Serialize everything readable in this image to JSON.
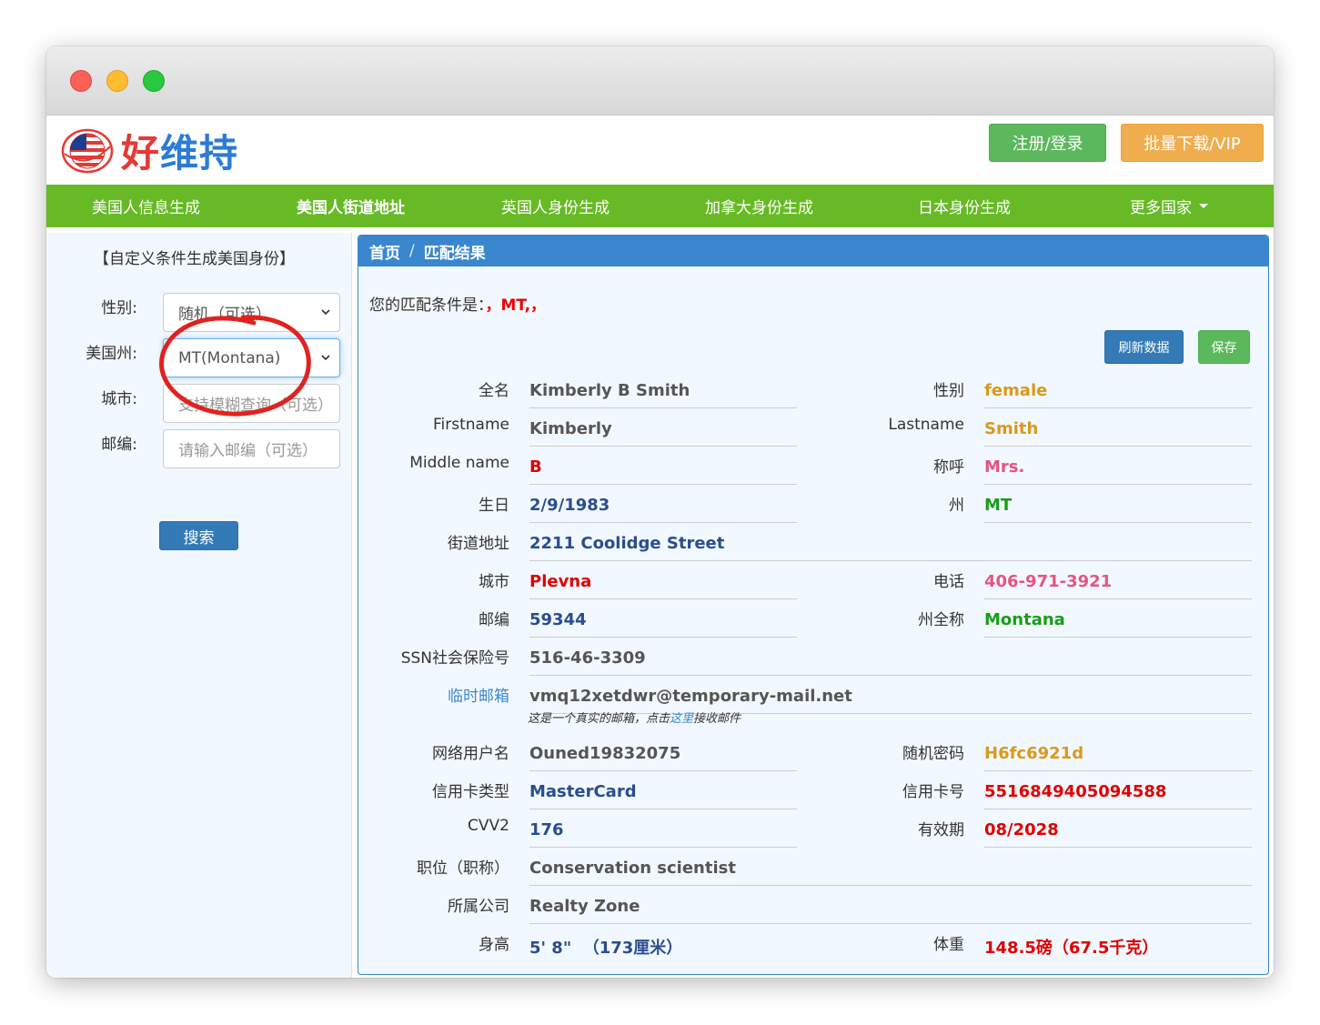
{
  "colors": {
    "green": "#67ba26",
    "blue": "#3a87d0",
    "red": "#e00000",
    "orange": "#d99a1c",
    "pink": "#e75480",
    "dark_blue": "#2a4d8f",
    "dark_green": "#1a9c1a"
  },
  "header": {
    "logo_text_1": "好",
    "logo_text_2": "维持",
    "register_label": "注册/登录",
    "vip_label": "批量下载/VIP"
  },
  "nav": {
    "items": [
      "美国人信息生成",
      "美国人街道地址",
      "英国人身份生成",
      "加拿大身份生成",
      "日本身份生成",
      "更多国家"
    ],
    "active_index": 1
  },
  "sidebar": {
    "title": "【自定义条件生成美国身份】",
    "gender_label": "性别:",
    "gender_value": "随机（可选）",
    "state_label": "美国州:",
    "state_value": "MT(Montana)",
    "city_label": "城市:",
    "city_placeholder": "支持模糊查询（可选）",
    "zip_label": "邮编:",
    "zip_placeholder": "请输入邮编（可选）",
    "search_label": "搜索"
  },
  "panel": {
    "breadcrumb_home": "首页",
    "breadcrumb_sep": "/",
    "breadcrumb_current": "匹配结果",
    "criteria_label": "您的匹配条件是：",
    "criteria_value": "，MT,，",
    "refresh_label": "刷新数据",
    "save_label": "保存",
    "temp_mail_hint_1": "这是一个真实的邮箱，点击",
    "temp_mail_hint_link": "这里",
    "temp_mail_hint_2": "接收邮件"
  },
  "fields": {
    "fullname": {
      "label": "全名",
      "value": "Kimberly B Smith"
    },
    "gender": {
      "label": "性别",
      "value": "female"
    },
    "firstname": {
      "label": "Firstname",
      "value": "Kimberly"
    },
    "lastname": {
      "label": "Lastname",
      "value": "Smith"
    },
    "middlename": {
      "label": "Middle name",
      "value": "B"
    },
    "title": {
      "label": "称呼",
      "value": "Mrs."
    },
    "birthday": {
      "label": "生日",
      "value": "2/9/1983"
    },
    "state": {
      "label": "州",
      "value": "MT"
    },
    "street": {
      "label": "街道地址",
      "value": "2211 Coolidge Street"
    },
    "city": {
      "label": "城市",
      "value": "Plevna"
    },
    "phone": {
      "label": "电话",
      "value": "406-971-3921"
    },
    "zip": {
      "label": "邮编",
      "value": "59344"
    },
    "state_full": {
      "label": "州全称",
      "value": "Montana"
    },
    "ssn": {
      "label": "SSN社会保险号",
      "value": "516-46-3309"
    },
    "temp_mail": {
      "label": "临时邮箱",
      "value": "vmq12xetdwr@temporary-mail.net"
    },
    "username": {
      "label": "网络用户名",
      "value": "Ouned19832075"
    },
    "password": {
      "label": "随机密码",
      "value": "H6fc6921d"
    },
    "card_type": {
      "label": "信用卡类型",
      "value": "MasterCard"
    },
    "card_number": {
      "label": "信用卡号",
      "value": "5516849405094588"
    },
    "cvv2": {
      "label": "CVV2",
      "value": "176"
    },
    "expiry": {
      "label": "有效期",
      "value": "08/2028"
    },
    "occupation": {
      "label": "职位（职称）",
      "value": "Conservation scientist"
    },
    "company": {
      "label": "所属公司",
      "value": "Realty Zone"
    },
    "height": {
      "label": "身高",
      "value": "5' 8\"  （173厘米）"
    },
    "weight": {
      "label": "体重",
      "value": "148.5磅（67.5千克）"
    }
  }
}
